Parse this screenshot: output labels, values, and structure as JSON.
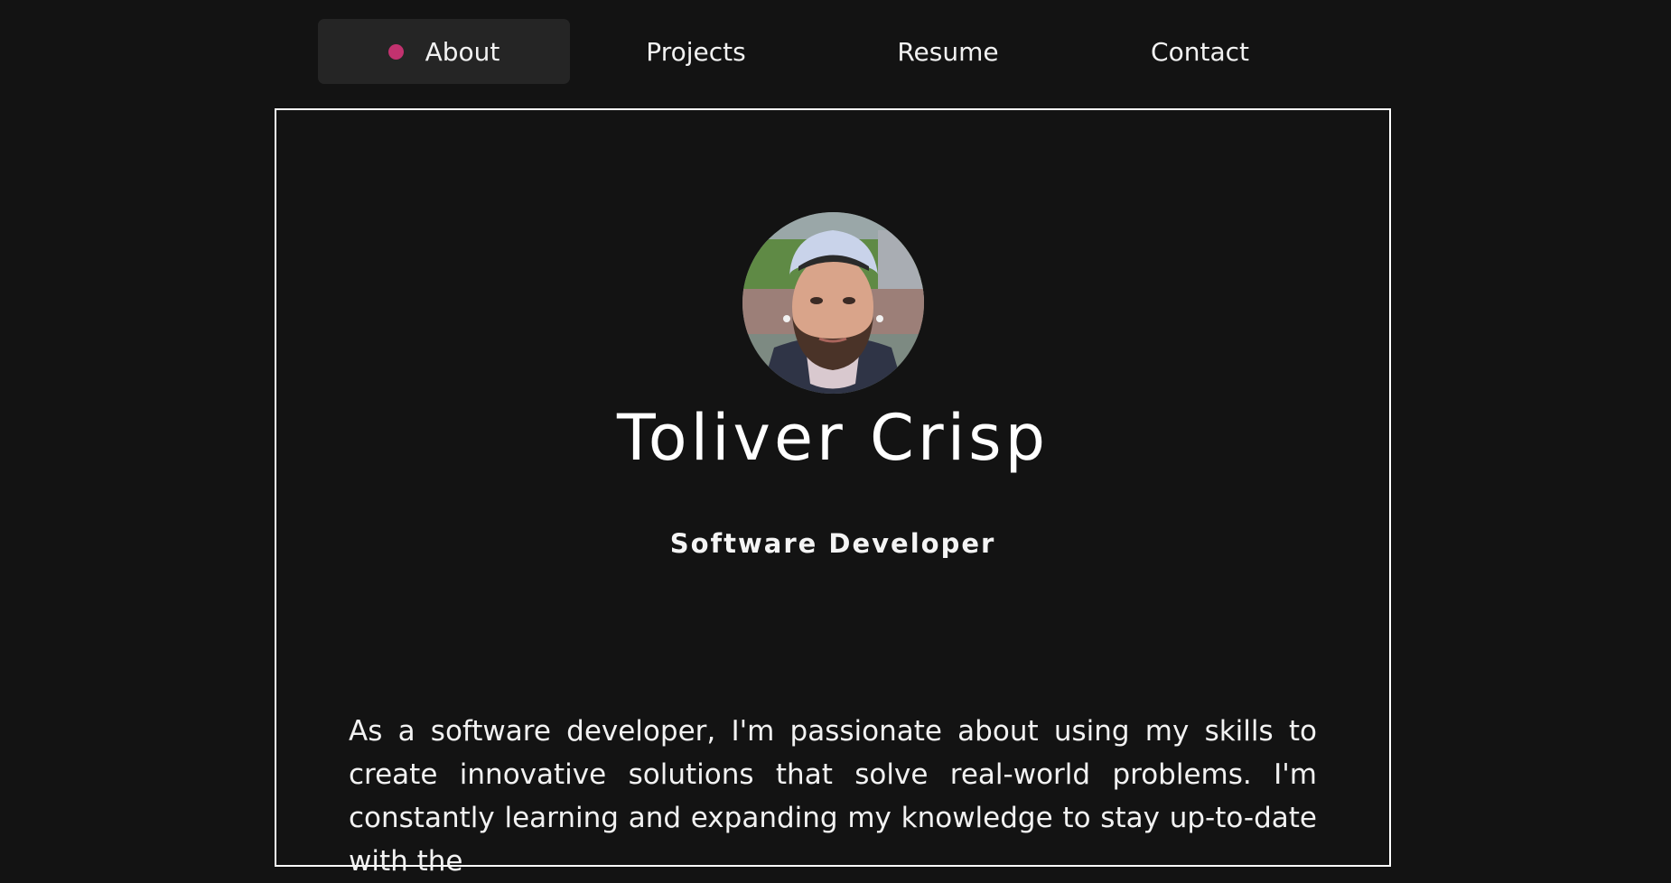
{
  "nav": {
    "items": [
      {
        "label": "About",
        "active": true
      },
      {
        "label": "Projects",
        "active": false
      },
      {
        "label": "Resume",
        "active": false
      },
      {
        "label": "Contact",
        "active": false
      }
    ],
    "active_dot_color": "#c2326f"
  },
  "profile": {
    "name": "Toliver Crisp",
    "role": "Software Developer",
    "bio": "As a software developer, I'm passionate about using my skills to create innovative solutions that solve real-world problems. I'm constantly learning and expanding my knowledge to stay up-to-date with the"
  }
}
